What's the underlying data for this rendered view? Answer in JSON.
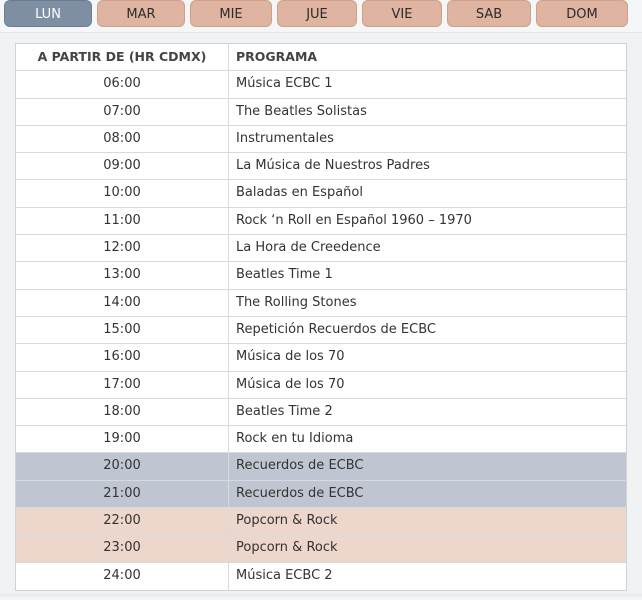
{
  "tabs": [
    {
      "label": "LUN",
      "active": true
    },
    {
      "label": "MAR",
      "active": false
    },
    {
      "label": "MIE",
      "active": false
    },
    {
      "label": "JUE",
      "active": false
    },
    {
      "label": "VIE",
      "active": false
    },
    {
      "label": "SAB",
      "active": false
    },
    {
      "label": "DOM",
      "active": false
    }
  ],
  "table": {
    "headers": {
      "time": "A PARTIR DE (HR CDMX)",
      "program": "PROGRAMA"
    },
    "rows": [
      {
        "time": "06:00",
        "program": "Música ECBC 1",
        "highlight": ""
      },
      {
        "time": "07:00",
        "program": "The Beatles Solistas",
        "highlight": ""
      },
      {
        "time": "08:00",
        "program": "Instrumentales",
        "highlight": ""
      },
      {
        "time": "09:00",
        "program": "La Música de Nuestros Padres",
        "highlight": ""
      },
      {
        "time": "10:00",
        "program": "Baladas en Español",
        "highlight": ""
      },
      {
        "time": "11:00",
        "program": "Rock ‘n Roll en Español 1960 – 1970",
        "highlight": ""
      },
      {
        "time": "12:00",
        "program": "La Hora de Creedence",
        "highlight": ""
      },
      {
        "time": "13:00",
        "program": "Beatles Time 1",
        "highlight": ""
      },
      {
        "time": "14:00",
        "program": "The Rolling Stones",
        "highlight": ""
      },
      {
        "time": "15:00",
        "program": "Repetición Recuerdos de ECBC",
        "highlight": ""
      },
      {
        "time": "16:00",
        "program": "Música de los 70",
        "highlight": ""
      },
      {
        "time": "17:00",
        "program": "Música de los 70",
        "highlight": ""
      },
      {
        "time": "18:00",
        "program": "Beatles Time 2",
        "highlight": ""
      },
      {
        "time": "19:00",
        "program": "Rock en tu Idioma",
        "highlight": ""
      },
      {
        "time": "20:00",
        "program": "Recuerdos de ECBC",
        "highlight": "blue"
      },
      {
        "time": "21:00",
        "program": "Recuerdos de ECBC",
        "highlight": "blue"
      },
      {
        "time": "22:00",
        "program": "Popcorn & Rock",
        "highlight": "peach"
      },
      {
        "time": "23:00",
        "program": "Popcorn & Rock",
        "highlight": "peach"
      },
      {
        "time": "24:00",
        "program": "Música ECBC 2",
        "highlight": ""
      }
    ]
  },
  "colors": {
    "tab_active": "#7e8fa3",
    "tab_inactive": "#dfb4a1",
    "highlight_blue": "#c0c6d1",
    "highlight_peach": "#edd6cb"
  }
}
